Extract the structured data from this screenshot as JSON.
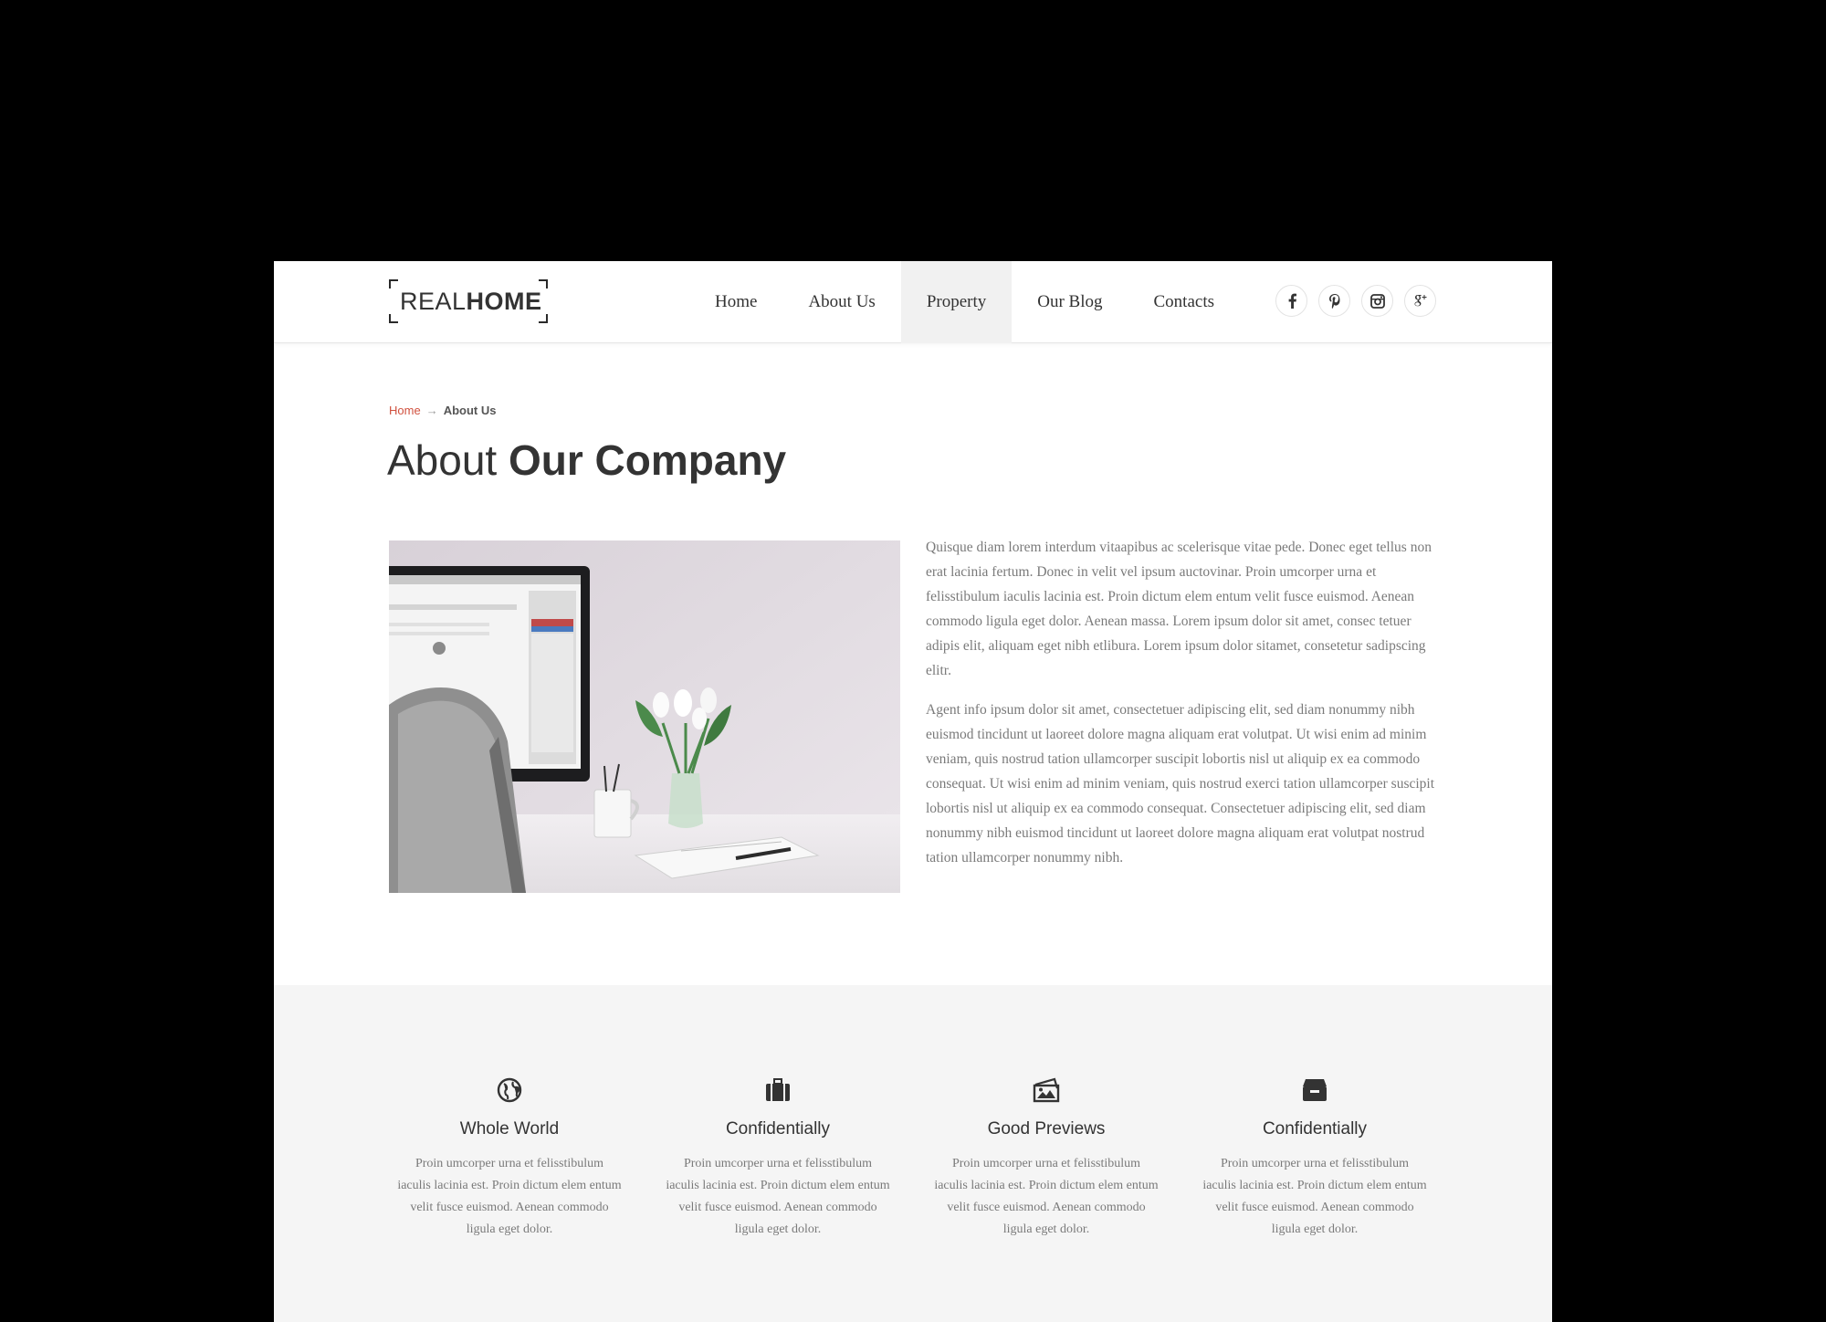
{
  "logo": {
    "light": "REAL",
    "bold": "HOME"
  },
  "nav": {
    "items": [
      {
        "label": "Home"
      },
      {
        "label": "About Us"
      },
      {
        "label": "Property"
      },
      {
        "label": "Our Blog"
      },
      {
        "label": "Contacts"
      }
    ],
    "active": "Property"
  },
  "social": [
    "facebook-icon",
    "pinterest-icon",
    "instagram-icon",
    "google-plus-icon"
  ],
  "breadcrumb": {
    "home": "Home",
    "separator": "→",
    "current": "About Us"
  },
  "title": {
    "light": "About",
    "bold": "Our Company"
  },
  "about": {
    "paragraphs": [
      "Quisque diam lorem interdum vitaapibus ac scelerisque vitae pede. Donec eget tellus non erat lacinia fertum. Donec in velit vel ipsum auctovinar. Proin umcorper urna et felisstibulum iaculis lacinia est. Proin dictum elem entum velit fusce euismod. Aenean commodo ligula eget dolor. Aenean massa. Lorem ipsum dolor sit amet, consec tetuer adipis elit, aliquam eget nibh etlibura. Lorem ipsum dolor sitamet, consetetur sadipscing elitr.",
      "Agent info ipsum dolor sit amet, consectetuer adipiscing elit, sed diam nonummy nibh euismod tincidunt ut laoreet dolore magna aliquam erat volutpat. Ut wisi enim ad minim veniam, quis nostrud tation ullamcorper suscipit lobortis nisl ut aliquip ex ea commodo consequat. Ut wisi enim ad minim veniam, quis nostrud exerci tation ullamcorper suscipit lobortis nisl ut aliquip ex ea commodo consequat. Consectetuer adipiscing elit, sed diam nonummy nibh euismod tincidunt ut laoreet dolore magna aliquam erat volutpat nostrud tation ullamcorper nonummy nibh."
    ]
  },
  "features": [
    {
      "icon": "globe-icon",
      "title": "Whole World",
      "text": "Proin umcorper urna et felisstibulum iaculis lacinia est. Proin dictum elem entum velit fusce euismod. Aenean commodo ligula eget dolor."
    },
    {
      "icon": "briefcase-icon",
      "title": "Confidentially",
      "text": "Proin umcorper urna et felisstibulum iaculis lacinia est. Proin dictum elem entum velit fusce euismod. Aenean commodo ligula eget dolor."
    },
    {
      "icon": "pictures-icon",
      "title": "Good Previews",
      "text": "Proin umcorper urna et felisstibulum iaculis lacinia est. Proin dictum elem entum velit fusce euismod. Aenean commodo ligula eget dolor."
    },
    {
      "icon": "archive-icon",
      "title": "Confidentially",
      "text": "Proin umcorper urna et felisstibulum iaculis lacinia est. Proin dictum elem entum velit fusce euismod. Aenean commodo ligula eget dolor."
    }
  ],
  "colors": {
    "accent": "#d0503e",
    "text": "#333333",
    "muted": "#7a7a7a",
    "band": "#f5f5f5",
    "active_nav": "#f1f1f1"
  }
}
